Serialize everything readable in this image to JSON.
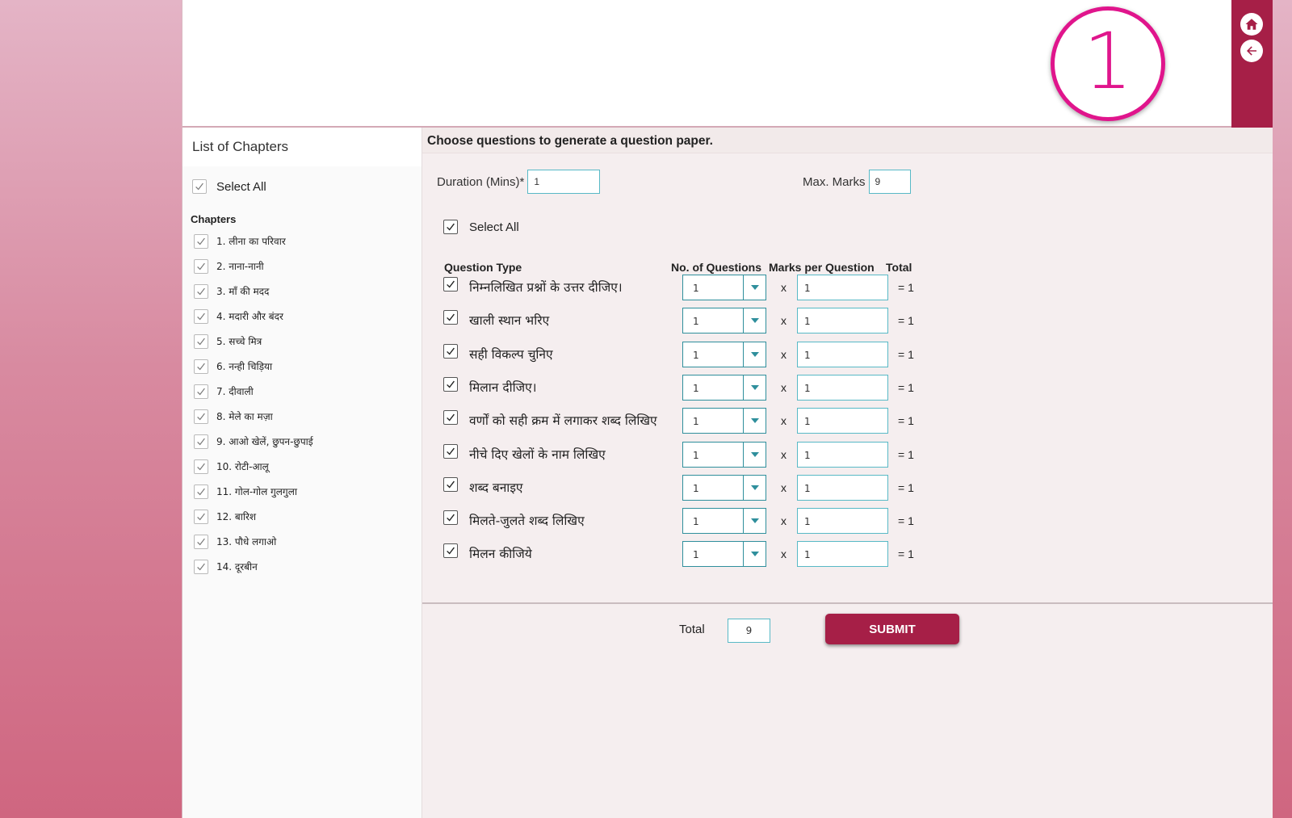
{
  "header": {
    "class_number": "1",
    "home_icon": "home-icon",
    "back_icon": "back-arrow-icon"
  },
  "sidebar": {
    "title": "List of Chapters",
    "select_all_label": "Select All",
    "select_all_checked": true,
    "chapters_heading": "Chapters",
    "chapters": [
      {
        "label": "1. लीना का परिवार",
        "checked": true
      },
      {
        "label": "2. नाना-नानी",
        "checked": true
      },
      {
        "label": "3. माँ की मदद",
        "checked": true
      },
      {
        "label": "4. मदारी और बंदर",
        "checked": true
      },
      {
        "label": "5. सच्चे मित्र",
        "checked": true
      },
      {
        "label": "6. नन्ही चिड़िया",
        "checked": true
      },
      {
        "label": "7. दीवाली",
        "checked": true
      },
      {
        "label": "8. मेले का मज़ा",
        "checked": true
      },
      {
        "label": "9. आओ खेलें, छुपन-छुपाई",
        "checked": true
      },
      {
        "label": "10. रोटी-आलू",
        "checked": true
      },
      {
        "label": "11. गोल-गोल गुलगुला",
        "checked": true
      },
      {
        "label": "12. बारिश",
        "checked": true
      },
      {
        "label": "13. पौधे लगाओ",
        "checked": true
      },
      {
        "label": "14. दूरबीन",
        "checked": true
      }
    ]
  },
  "main": {
    "heading": "Choose questions to generate a question paper.",
    "duration_label": "Duration (Mins)*",
    "duration_value": "1",
    "max_marks_label": "Max. Marks",
    "max_marks_value": "9",
    "select_all_label": "Select All",
    "columns": {
      "question_type": "Question Type",
      "num_questions": "No. of Questions",
      "marks_per_question": "Marks per Question",
      "total": "Total"
    },
    "multiply_sign": "x",
    "questions": [
      {
        "type": "निम्नलिखित प्रश्नों के उत्तर दीजिए।",
        "count": "1",
        "marks": "1",
        "total": "= 1",
        "checked": true
      },
      {
        "type": "खाली स्थान भरिए",
        "count": "1",
        "marks": "1",
        "total": "= 1",
        "checked": true
      },
      {
        "type": "सही विकल्प चुनिए",
        "count": "1",
        "marks": "1",
        "total": "= 1",
        "checked": true
      },
      {
        "type": "मिलान दीजिए।",
        "count": "1",
        "marks": "1",
        "total": "= 1",
        "checked": true
      },
      {
        "type": "वर्णों को सही क्रम में लगाकर शब्द लिखिए",
        "count": "1",
        "marks": "1",
        "total": "= 1",
        "checked": true
      },
      {
        "type": "नीचे दिए खेलों के नाम लिखिए",
        "count": "1",
        "marks": "1",
        "total": "= 1",
        "checked": true
      },
      {
        "type": "शब्द बनाइए",
        "count": "1",
        "marks": "1",
        "total": "= 1",
        "checked": true
      },
      {
        "type": "मिलते-जुलते शब्द लिखिए",
        "count": "1",
        "marks": "1",
        "total": "= 1",
        "checked": true
      },
      {
        "type": "मिलन कीजिये",
        "count": "1",
        "marks": "1",
        "total": "= 1",
        "checked": true
      }
    ]
  },
  "footer": {
    "total_label": "Total",
    "total_value": "9",
    "submit_label": "SUBMIT"
  },
  "colors": {
    "accent": "#a61f47",
    "logo": "#e0158c",
    "input_border": "#58b9c6"
  }
}
